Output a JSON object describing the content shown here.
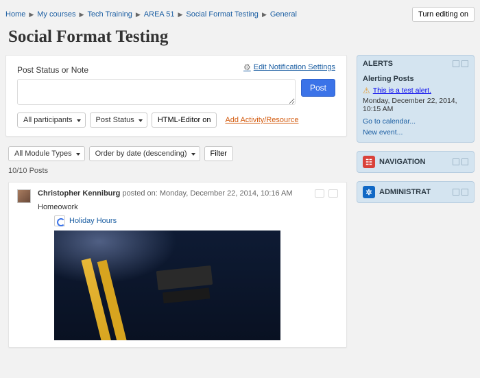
{
  "breadcrumbs": [
    "Home",
    "My courses",
    "Tech Training",
    "AREA 51",
    "Social Format Testing",
    "General"
  ],
  "editing_button": "Turn editing on",
  "page_title": "Social Format Testing",
  "postbox": {
    "edit_notif": "Edit Notification Settings",
    "heading": "Post Status or Note",
    "post_button": "Post",
    "select_audience": "All participants",
    "select_type": "Post Status",
    "html_editor": "HTML-Editor on",
    "add_activity": "Add Activity/Resource"
  },
  "filters": {
    "module_types": "All Module Types",
    "order": "Order by date (descending)",
    "filter_btn": "Filter"
  },
  "posts_count": "10/10 Posts",
  "post": {
    "author": "Christopher Kenniburg",
    "posted_prefix": " posted on: ",
    "timestamp": "Monday, December 22, 2014, 10:16 AM",
    "content": "Homeowork",
    "attachment_name": "Holiday Hours"
  },
  "sidebar": {
    "alerts": {
      "title": "ALERTS",
      "subheading": "Alerting Posts",
      "alert_text": "This is a test alert.",
      "alert_time": "Monday, December 22, 2014, 10:15 AM",
      "calendar_link": "Go to calendar...",
      "new_event_link": "New event..."
    },
    "navigation": {
      "title": "NAVIGATION"
    },
    "administration": {
      "title": "ADMINISTRAT"
    }
  }
}
